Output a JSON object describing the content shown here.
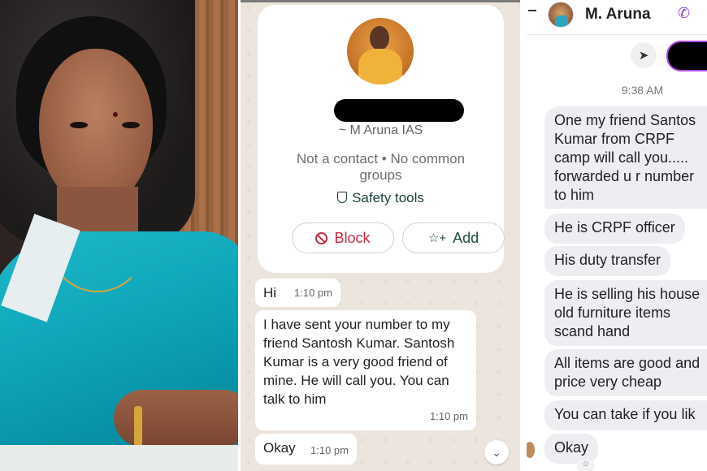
{
  "whatsapp": {
    "profile_subname": "~ M Aruna IAS",
    "contact_info": "Not a contact • No common groups",
    "safety_tools": "Safety tools",
    "block_label": "Block",
    "add_label": "Add",
    "messages": [
      {
        "text": "Hi",
        "time": "1:10 pm"
      },
      {
        "text": "I have sent your number to my friend Santosh Kumar. Santosh Kumar is a very good friend of mine. He will call you. You can talk to him",
        "time": "1:10 pm"
      },
      {
        "text": "Okay",
        "time": "1:10 pm"
      }
    ],
    "scroll_down_icon": "chevron-double-down-icon"
  },
  "sms": {
    "contact_name": "M. Aruna",
    "phone_icon": "phone-icon",
    "share_icon": "share-icon",
    "timestamp": "9:38 AM",
    "messages": [
      "One my friend Santos\nKumar from CRPF\ncamp will call you.....\nforwarded u r number\nto him",
      "He is CRPF officer",
      "His duty transfer",
      "He is selling his house\nold furniture items\nscand hand",
      "All items are good and\nprice very cheap",
      "You can take if you lik",
      "Okay"
    ],
    "accent_color": "#8c3fd0"
  },
  "colors": {
    "block_red": "#c5283d",
    "wa_background": "#ece5dd",
    "saree_teal": "#0fa6ba"
  }
}
